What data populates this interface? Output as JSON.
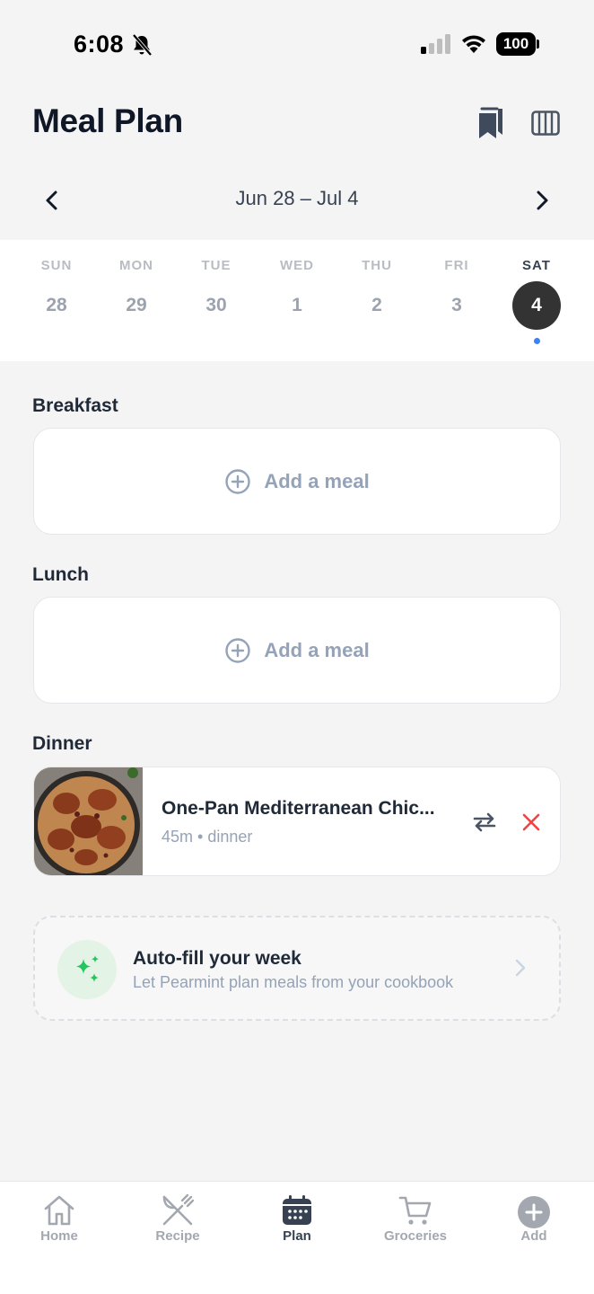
{
  "status_bar": {
    "time": "6:08",
    "battery": "100"
  },
  "header": {
    "title": "Meal Plan"
  },
  "week": {
    "range": "Jun 28 – Jul 4"
  },
  "days": [
    {
      "name": "SUN",
      "num": "28"
    },
    {
      "name": "MON",
      "num": "29"
    },
    {
      "name": "TUE",
      "num": "30"
    },
    {
      "name": "WED",
      "num": "1"
    },
    {
      "name": "THU",
      "num": "2"
    },
    {
      "name": "FRI",
      "num": "3"
    },
    {
      "name": "SAT",
      "num": "4",
      "selected": true
    }
  ],
  "sections": {
    "breakfast": {
      "label": "Breakfast",
      "add_label": "Add a meal"
    },
    "lunch": {
      "label": "Lunch",
      "add_label": "Add a meal"
    },
    "dinner": {
      "label": "Dinner",
      "meal": {
        "title": "One-Pan Mediterranean Chic...",
        "meta": "45m • dinner"
      }
    }
  },
  "autofill": {
    "title": "Auto-fill your week",
    "subtitle": "Let Pearmint plan meals from your cookbook"
  },
  "tabs": [
    {
      "label": "Home",
      "icon": "home-icon"
    },
    {
      "label": "Recipe",
      "icon": "utensils-icon"
    },
    {
      "label": "Plan",
      "icon": "calendar-icon",
      "active": true
    },
    {
      "label": "Groceries",
      "icon": "cart-icon"
    },
    {
      "label": "Add",
      "icon": "plus-circle-icon"
    }
  ],
  "colors": {
    "background": "#f4f4f4",
    "selected_day": "#333333",
    "today_dot": "#3b82f6",
    "remove": "#ef4444",
    "sparkle": "#22c55e",
    "muted": "#94a3b8"
  }
}
